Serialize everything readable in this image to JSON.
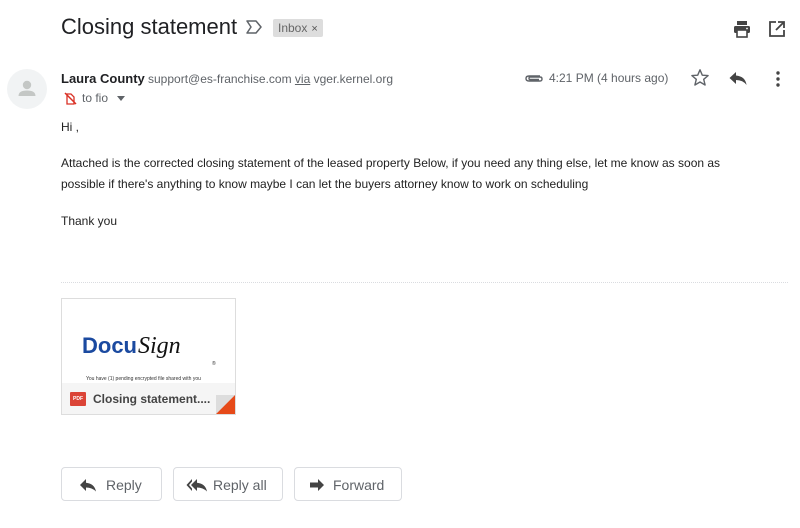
{
  "header": {
    "subject": "Closing statement",
    "label": "Inbox",
    "label_close": "×"
  },
  "message": {
    "sender_name": "Laura County",
    "sender_email": "support@es-franchise.com",
    "via_word": "via",
    "via_domain": "vger.kernel.org",
    "to_line": "to fio",
    "timestamp": "4:21 PM (4 hours ago)"
  },
  "body": {
    "greeting": "Hi ,",
    "para1": "Attached is the corrected closing statement of the leased property Below, if you need any thing else, let me know as soon as",
    "para2": "possible if there's anything to know maybe I can let the buyers attorney know to work on scheduling",
    "signoff": "Thank you"
  },
  "attachment": {
    "logo_part1": "Docu",
    "logo_part2": "Sign",
    "logo_reg": "®",
    "preview_caption": "You have (1) pending encrypted file shared with you",
    "file_badge": "PDF",
    "file_name": "Closing statement...."
  },
  "actions": {
    "reply_label": "Reply",
    "reply_all_label": "Reply all",
    "forward_label": "Forward"
  },
  "icons": {
    "importance": "importance-marker-icon",
    "print": "print-icon",
    "popout": "open-in-new-window-icon",
    "avatar": "person-avatar-icon",
    "unsafe": "unsafe-sender-icon",
    "attachment": "paperclip-icon",
    "star": "star-icon",
    "reply": "reply-arrow-icon",
    "more": "more-vertical-icon",
    "reply_all": "reply-all-icon",
    "forward": "forward-arrow-icon"
  },
  "colors": {
    "docusign_blue": "#1b4aa0",
    "pdf_red": "#db4437",
    "corner_red": "#e64a19",
    "label_bg": "#dddddd"
  }
}
